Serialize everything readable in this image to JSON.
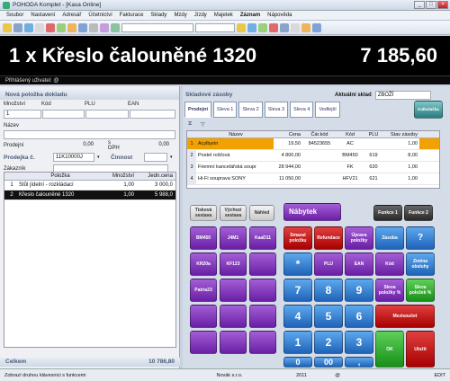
{
  "window": {
    "title": "POHODA Komplet - [Kasa Online]"
  },
  "menu": [
    "Soubor",
    "Nastavení",
    "Adresář",
    "Účetnictví",
    "Fakturace",
    "Sklady",
    "Mzdy",
    "Jízdy",
    "Majetek",
    "Záznam",
    "Nápověda"
  ],
  "display": {
    "left": "1 x  Křeslo čalouněné 1320",
    "right": "7 185,60"
  },
  "user_bar": "Přihlášený uživatel: @",
  "new_item": {
    "title": "Nová položka dokladu",
    "labels": {
      "qty": "Množství",
      "code": "Kód",
      "plu": "PLU",
      "ean": "EAN",
      "name": "Název",
      "price": "Prodejní",
      "vat": "s DPH"
    },
    "qty": "1",
    "price_left": "0,00",
    "price_right": "0,00"
  },
  "sale": {
    "label": "Prodejka č.",
    "number": "11K10000J",
    "activity": "Činnost",
    "customer": "Zákazník"
  },
  "lines": {
    "headers": [
      "",
      "Položka",
      "Množství",
      "Jedn.cena"
    ],
    "rows": [
      [
        "1",
        "Stůl jídelní - rozkládací",
        "1,00",
        "3 000,0"
      ],
      [
        "2",
        "Křeslo čalouněné 1320",
        "1,00",
        "5 988,0"
      ]
    ]
  },
  "total": {
    "label": "Celkem",
    "value": "10 786,80"
  },
  "stock": {
    "title": "Skladové zásoby",
    "current_label": "Aktuální sklad",
    "current": "ZBOŽÍ",
    "tabs": [
      "Prodejní",
      "Sleva 1",
      "Sleva 2",
      "Sleva 3",
      "Sleva 4",
      "Vedlejší"
    ],
    "calc": "Kalkulačka",
    "headers": [
      "",
      "Název",
      "Cena",
      "Čár.kód",
      "Kód",
      "PLU",
      "Stav zásoby"
    ],
    "rows": [
      [
        "1",
        "Acylbyrin",
        "19,50",
        "84523655",
        "AC",
        "",
        "1,00"
      ],
      [
        "2",
        "Postel rošťová",
        "4 800,00",
        "",
        "BM450",
        "619",
        "8,00"
      ],
      [
        "3",
        "Firemní kancelářská soupr",
        "28 944,00",
        "",
        "FK",
        "620",
        "1,00"
      ],
      [
        "4",
        "Hi-Fi souprava SONY",
        "11 050,00",
        "",
        "HFV21",
        "621",
        "1,00"
      ]
    ]
  },
  "keys": {
    "typical": "Tisková sestava",
    "default": "Výchozí sestava",
    "preview": "Náhled",
    "group": "Nábytek",
    "f1": "Funkce 1",
    "f2": "Funkce 2",
    "p1": "BM450",
    "p2": "J4M1",
    "p3": "KaaD11",
    "p4": "KR20a",
    "p5": "KF123",
    "p6": "Patria23",
    "storno": "Smazat položku",
    "refund": "Refundace",
    "edit": "Úprava položky",
    "stock_key": "Zásoba",
    "help": "?",
    "star": "*",
    "plu": "PLU",
    "ean": "EAN",
    "kod": "Kód",
    "change": "Změna obsluhy",
    "d7": "7",
    "d8": "8",
    "d9": "9",
    "disc": "Sleva položky %",
    "discall": "Sleva položek %",
    "d4": "4",
    "d5": "5",
    "d6": "6",
    "cashbox": "Mezisoučet",
    "d1": "1",
    "d2": "2",
    "d3": "3",
    "d0": "0",
    "d00": "00",
    "comma": ",",
    "ok": "OK",
    "pay": "Uložit"
  },
  "status": {
    "hint": "Zobrazí druhou klávesnici s funkcemi",
    "company": "Novák s.r.o.",
    "year": "2011",
    "at": "@",
    "mode": "EDIT"
  }
}
